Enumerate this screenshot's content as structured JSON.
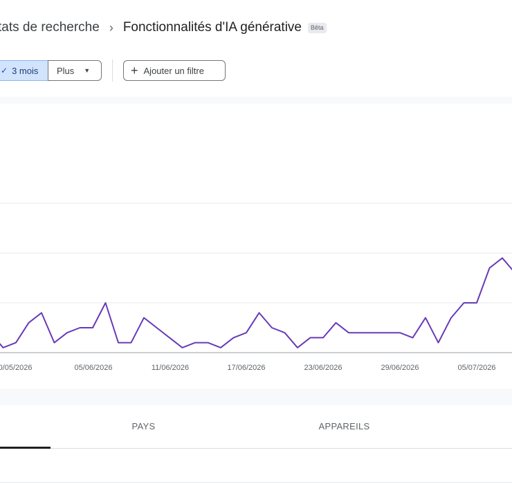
{
  "breadcrumb": {
    "parent": "tats de recherche",
    "separator": "›",
    "current": "Fonctionnalités d'IA générative",
    "badge": "Bêta"
  },
  "filters": {
    "range_check": "✓",
    "range_label": "3 mois",
    "more_label": "Plus",
    "more_caret": "▼",
    "add_filter_icon": "+",
    "add_filter_label": "Ajouter un filtre"
  },
  "chart_data": {
    "type": "line",
    "x_tick_labels": [
      "0/05/2026",
      "05/06/2026",
      "11/06/2026",
      "17/06/2026",
      "23/06/2026",
      "29/06/2026",
      "05/07/2026"
    ],
    "series": [
      {
        "color": "#673ab7",
        "values": [
          4,
          1,
          2,
          6,
          8,
          2,
          4,
          5,
          5,
          10,
          2,
          2,
          7,
          5,
          3,
          1,
          2,
          2,
          1,
          3,
          4,
          8,
          5,
          4,
          1,
          3,
          3,
          6,
          4,
          4,
          4,
          4,
          4,
          3,
          7,
          2,
          7,
          10,
          10,
          17,
          19,
          16,
          17
        ]
      }
    ],
    "ylim": [
      0,
      30
    ],
    "grid": true
  },
  "tabs": [
    {
      "label": "PAYS"
    },
    {
      "label": "APPAREILS"
    }
  ]
}
